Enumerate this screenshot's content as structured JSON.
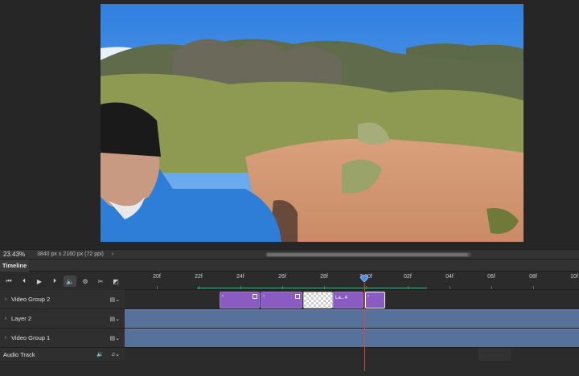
{
  "status_bar": {
    "zoom": "23.43%",
    "doc_info": "3840 px x 2160 px (72 ppi)",
    "arrow": "›"
  },
  "timeline": {
    "tab_label": "Timeline",
    "controls": [
      {
        "icon": "go-to-first-frame-icon",
        "glyph": "⏮"
      },
      {
        "icon": "previous-frame-icon",
        "glyph": "⏴"
      },
      {
        "icon": "play-icon",
        "glyph": "▶"
      },
      {
        "icon": "next-frame-icon",
        "glyph": "⏵"
      },
      {
        "icon": "audio-mute-icon",
        "glyph": "🔈"
      },
      {
        "icon": "settings-gear-icon",
        "glyph": "⚙"
      },
      {
        "icon": "scissors-icon",
        "glyph": "✂"
      },
      {
        "icon": "transition-icon",
        "glyph": "◩"
      }
    ],
    "ruler": [
      "20f",
      "22f",
      "24f",
      "26f",
      "28f",
      "2:00f",
      "02f",
      "04f",
      "06f",
      "08f",
      "10f"
    ],
    "tracks": [
      {
        "label": "Video Group 2",
        "chevron": "›",
        "film": "▤⌄"
      },
      {
        "label": "Layer 2",
        "chevron": "›",
        "film": "▤⌄"
      },
      {
        "label": "Video Group 1",
        "chevron": "›",
        "film": "▤⌄"
      }
    ],
    "clips": {
      "labeled_clip": "La...4",
      "chevron": "›"
    },
    "audio_track": {
      "label": "Audio Track",
      "speaker": "🔉",
      "note": "♫⌄"
    }
  }
}
